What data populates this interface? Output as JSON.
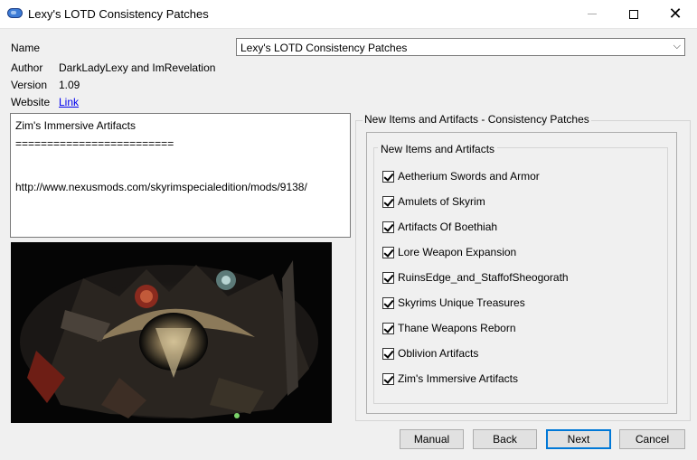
{
  "window": {
    "title": "Lexy's LOTD Consistency Patches"
  },
  "info": {
    "name_label": "Name",
    "name_value": "Lexy's LOTD Consistency Patches",
    "author_label": "Author",
    "author_value": "DarkLadyLexy and ImRevelation",
    "version_label": "Version",
    "version_value": "1.09",
    "website_label": "Website",
    "website_link": "Link"
  },
  "description": {
    "line1": "Zim's Immersive Artifacts",
    "line2": "=========================",
    "line3": "http://www.nexusmods.com/skyrimspecialedition/mods/9138/"
  },
  "options": {
    "step_title": "New Items and Artifacts - Consistency Patches",
    "group_title": "New Items and Artifacts",
    "items": [
      {
        "label": "Aetherium Swords and Armor",
        "checked": true
      },
      {
        "label": "Amulets of Skyrim",
        "checked": true
      },
      {
        "label": "Artifacts Of Boethiah",
        "checked": true
      },
      {
        "label": "Lore Weapon Expansion",
        "checked": true
      },
      {
        "label": "RuinsEdge_and_StaffofSheogorath",
        "checked": true
      },
      {
        "label": "Skyrims Unique Treasures",
        "checked": true
      },
      {
        "label": "Thane Weapons Reborn",
        "checked": true
      },
      {
        "label": "Oblivion Artifacts",
        "checked": true
      },
      {
        "label": "Zim's Immersive Artifacts",
        "checked": true
      }
    ]
  },
  "buttons": {
    "manual": "Manual",
    "back": "Back",
    "next": "Next",
    "cancel": "Cancel"
  },
  "colors": {
    "accent": "#0078d7",
    "link": "#0000ee"
  }
}
